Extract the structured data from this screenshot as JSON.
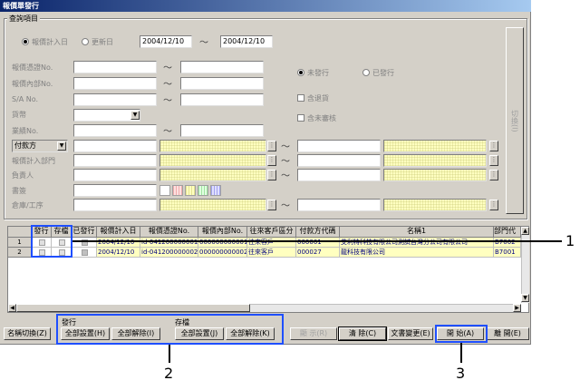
{
  "window": {
    "title": "報價單發行"
  },
  "query": {
    "legend": "查詢項目",
    "radio_quote_date": "報價計入日",
    "radio_update_date": "更新日",
    "date_from": "2004/12/10",
    "date_to": "2004/12/10",
    "tilde": "〜",
    "labels": {
      "quote_no": "報價憑證No.",
      "quote_internal_no": "報價內部No.",
      "sa_no": "S/A No.",
      "currency": "貨幣",
      "business_no": "業績No.",
      "pay_type": "付款方",
      "quote_entry_dept": "報價計入部門",
      "staff": "負責人",
      "doc": "書簽",
      "warehouse": "倉庫/工序"
    },
    "status_unissued": "未發行",
    "status_issued": "已發行",
    "chk_include_declined": "含退貨",
    "chk_include_unapproved": "含未審核",
    "switch_button": "切換(I)"
  },
  "table": {
    "headers": [
      "發行",
      "存檔",
      "已發行",
      "報價計入日",
      "報價憑證No.",
      "報價內部No.",
      "往來客戶區分",
      "付款方代碼",
      "名稱1",
      "部門代"
    ],
    "rows": [
      {
        "num": "1",
        "date": "2004/12/10",
        "quote_no": "id-041200000001",
        "internal_no": "000000000001",
        "cust_type": "往來客戶",
        "payer_code": "000001",
        "name": "艾利特科技有限公司測試台灣分公司有限公司",
        "dept": "B7002"
      },
      {
        "num": "2",
        "date": "2004/12/10",
        "quote_no": "id-041200000002",
        "internal_no": "000000000002",
        "cust_type": "往來客戶",
        "payer_code": "000027",
        "name": "龍科技有限公司",
        "dept": "B7001"
      }
    ]
  },
  "bottom": {
    "name_switch": "名稱切換(Z)",
    "issue_group": "發行",
    "archive_group": "存檔",
    "issue_select_all": "全部設置(H)",
    "issue_clear_all": "全部解除(I)",
    "archive_select_all": "全部設置(J)",
    "archive_clear_all": "全部解除(K)",
    "display": "顯 示(R)",
    "clear": "清 除(C)",
    "doc_change": "文書變更(E)",
    "start": "開 始(A)",
    "close": "離 開(E)"
  },
  "callouts": {
    "c1": "1",
    "c2": "2",
    "c3": "3"
  },
  "colors": {
    "highlight": "#1f4fff",
    "title_start": "#0a246a",
    "yellow_field": "#ffffc0"
  }
}
